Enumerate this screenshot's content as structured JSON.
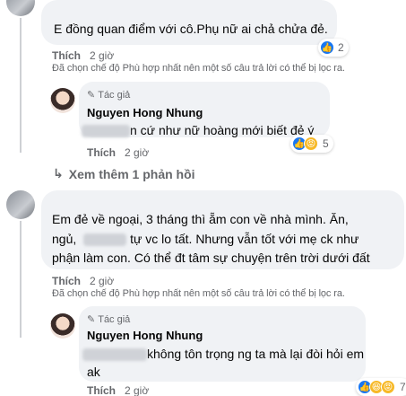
{
  "comment1": {
    "text": "E đồng quan điểm với cô.Phụ nữ ai chả chửa đẻ.",
    "react_count": "2",
    "like_label": "Thích",
    "time": "2 giờ",
    "notice": "Đã chọn chế độ Phù hợp nhất nên một số câu trả lời có thể bị lọc ra."
  },
  "reply1": {
    "role": "Tác giả",
    "author": "Nguyen Hong Nhung",
    "text": "n cứ như nữ hoàng mới biết đẻ ý",
    "react_count": "5",
    "like_label": "Thích",
    "time": "2 giờ"
  },
  "more_replies": "Xem thêm 1 phản hồi",
  "comment2": {
    "line1": "Em đẻ về ngoại, 3 tháng thì ẵm con về nhà mình. Ăn,",
    "line2_a": "ngủ,",
    "line2_b": "tự vc lo tất. Nhưng vẫn tốt với mẹ ck như",
    "line3": "phận làm con. Có thể đt tâm sự chuyện trên trời dưới đất",
    "like_label": "Thích",
    "time": "2 giờ",
    "notice": "Đã chọn chế độ Phù hợp nhất nên một số câu trả lời có thể bị lọc ra."
  },
  "reply2": {
    "role": "Tác giả",
    "author": "Nguyen Hong Nhung",
    "line1": "không tôn trọng ng ta mà lại đòi hỏi em",
    "line2": "ak",
    "react_count": "7",
    "like_label": "Thích",
    "time": "2 giờ"
  },
  "colors": {
    "bubble": "#f0f2f5",
    "like_blue": "#1877f2",
    "muted": "#65676b"
  }
}
